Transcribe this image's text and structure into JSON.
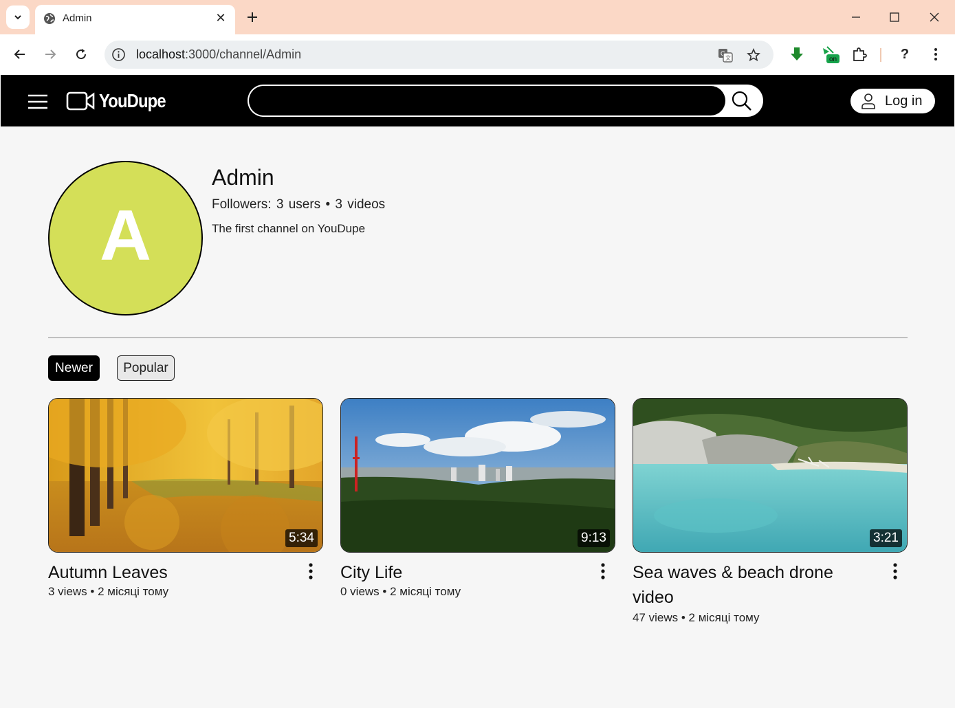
{
  "browser": {
    "tab_title": "Admin",
    "url_host": "localhost",
    "url_rest": ":3000/channel/Admin",
    "accent_color": "#fbd8c6",
    "extension_badge": "on"
  },
  "header": {
    "logo_text": "YouDupe",
    "search_placeholder": "",
    "login_label": "Log in"
  },
  "channel": {
    "avatar_letter": "A",
    "avatar_color": "#d4df58",
    "name": "Admin",
    "stats": "Followers: 3 users • 3 videos",
    "description": "The first channel on YouDupe"
  },
  "sort": {
    "newer_label": "Newer",
    "popular_label": "Popular",
    "active": "Newer"
  },
  "videos": [
    {
      "title": "Autumn Leaves",
      "duration": "5:34",
      "meta": "3 views • 2 місяці тому"
    },
    {
      "title": "City Life",
      "duration": "9:13",
      "meta": "0 views • 2 місяці тому"
    },
    {
      "title": "Sea waves & beach drone video",
      "duration": "3:21",
      "meta": "47 views • 2 місяці тому"
    }
  ]
}
